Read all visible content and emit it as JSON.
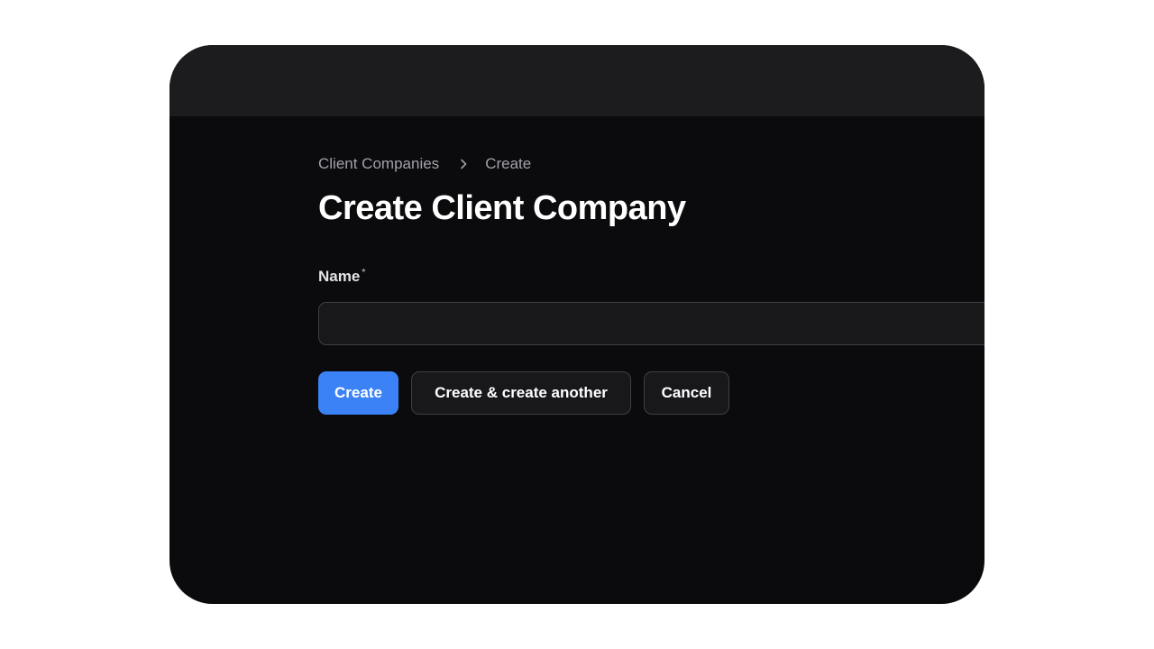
{
  "breadcrumb": {
    "items": [
      "Client Companies",
      "Create"
    ]
  },
  "page": {
    "title": "Create Client Company"
  },
  "form": {
    "name_label": "Name",
    "name_required_mark": "*",
    "name_value": "",
    "name_placeholder": ""
  },
  "actions": {
    "create_label": "Create",
    "create_another_label": "Create & create another",
    "cancel_label": "Cancel"
  },
  "icons": {
    "breadcrumb_separator": "chevron-right-icon"
  },
  "colors": {
    "primary": "#3b82f6",
    "background": "#0b0b0d",
    "topbar": "#1c1c1e"
  }
}
